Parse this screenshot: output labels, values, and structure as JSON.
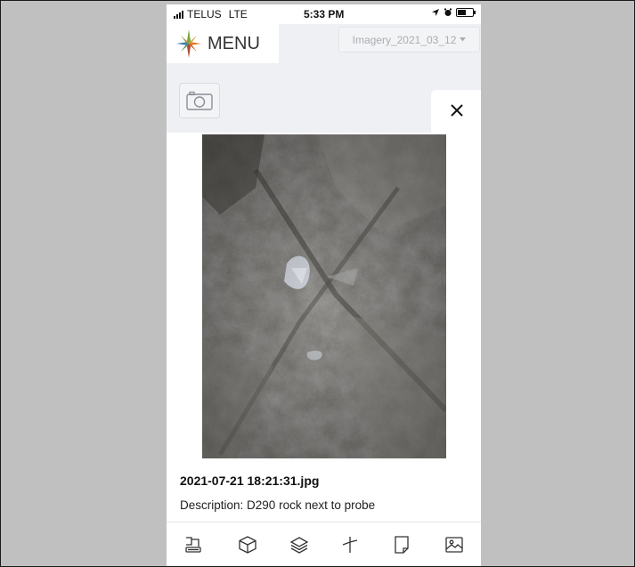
{
  "status_bar": {
    "carrier": "TELUS",
    "network": "LTE",
    "time": "5:33 PM"
  },
  "header": {
    "menu_label": "MENU",
    "logo_icon": "four-point-star-logo",
    "imagery_select": {
      "selected": "Imagery_2021_03_12",
      "icon": "caret-down-icon"
    }
  },
  "camera_button": {
    "icon": "camera-icon"
  },
  "close_button": {
    "icon": "close-icon",
    "glyph": "×"
  },
  "photo_panel": {
    "filename": "2021-07-21 18:21:31.jpg",
    "description_label": "Description",
    "description_value": "D290 rock next to probe"
  },
  "bottom_toolbar": {
    "items": [
      {
        "icon": "survey-marker-icon"
      },
      {
        "icon": "cube-icon"
      },
      {
        "icon": "layers-icon"
      },
      {
        "icon": "measure-line-icon"
      },
      {
        "icon": "note-page-icon"
      },
      {
        "icon": "image-icon"
      }
    ]
  },
  "colors": {
    "app_background": "#eef0f3",
    "logo_green": "#7aa63a",
    "logo_orange": "#e07b2a",
    "logo_blue": "#3f7fb0",
    "logo_red": "#b5462f"
  }
}
